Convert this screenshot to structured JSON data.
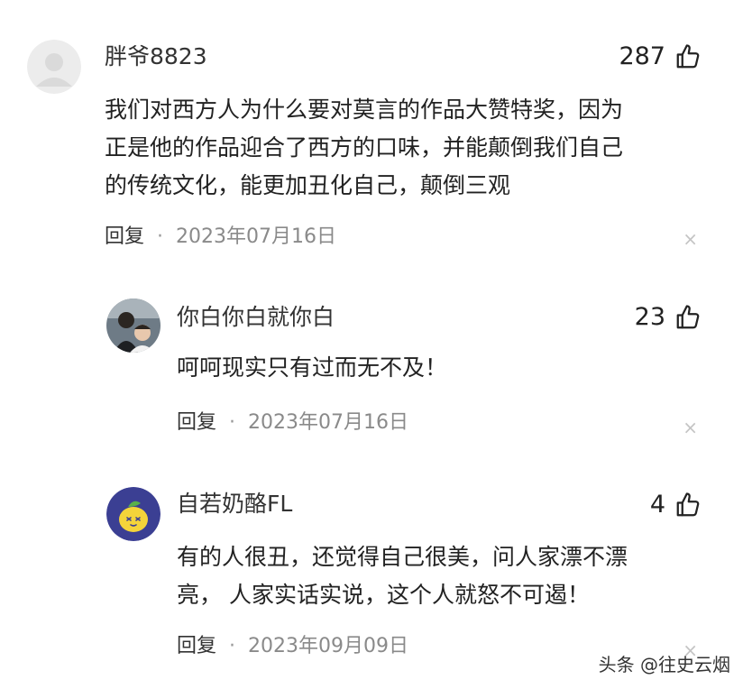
{
  "comments": [
    {
      "username": "胖爷8823",
      "likes": "287",
      "text_lines": [
        "我们对西方人为什么要对莫言的作品大赞特奖，因为",
        "正是他的作品迎合了西方的口味，并能颠倒我们自己",
        "的传统文化，能更加丑化自己，颠倒三观"
      ],
      "reply_label": "回复",
      "separator": "·",
      "date": "2023年07月16日",
      "close": "×"
    },
    {
      "username": "你白你白就你白",
      "likes": "23",
      "text_lines": [
        "呵呵现实只有过而无不及！"
      ],
      "reply_label": "回复",
      "separator": "·",
      "date": "2023年07月16日",
      "close": "×"
    },
    {
      "username": "自若奶酪FL",
      "likes": "4",
      "text_lines": [
        "有的人很丑，还觉得自己很美，问人家漂不漂",
        "亮， 人家实话实说，这个人就怒不可遏！"
      ],
      "reply_label": "回复",
      "separator": "·",
      "date": "2023年09月09日",
      "close": "×"
    }
  ],
  "watermark": "头条 @往史云烟",
  "icons": [
    "thumbs-up-icon",
    "close-icon",
    "avatar-placeholder-icon",
    "lemon-avatar-icon"
  ],
  "colors": {
    "text": "#222222",
    "meta": "#8a8a8a",
    "close": "#c4c4c4",
    "lemon_bg": "#3b3f93",
    "lemon": "#f4d43a"
  }
}
